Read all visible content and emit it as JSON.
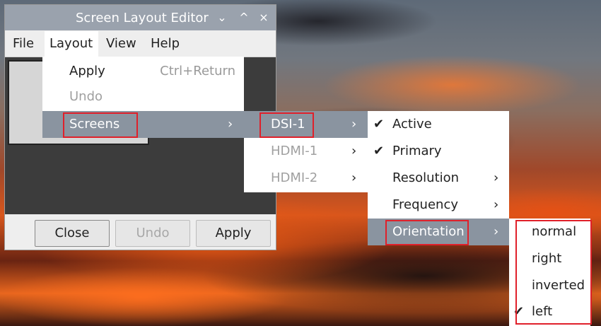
{
  "window": {
    "title": "Screen Layout Editor",
    "controls": {
      "minimize": "⌄",
      "maximize": "^",
      "close": "×"
    }
  },
  "menubar": {
    "items": [
      "File",
      "Layout",
      "View",
      "Help"
    ]
  },
  "layout_menu": {
    "apply": "Apply",
    "apply_shortcut": "Ctrl+Return",
    "undo": "Undo",
    "screens": "Screens"
  },
  "screens_menu": {
    "items": [
      "DSI-1",
      "HDMI-1",
      "HDMI-2"
    ]
  },
  "dsi_menu": {
    "active": "Active",
    "primary": "Primary",
    "resolution": "Resolution",
    "frequency": "Frequency",
    "orientation": "Orientation"
  },
  "orientation_menu": {
    "items": [
      "normal",
      "right",
      "inverted",
      "left"
    ],
    "checked": "left"
  },
  "buttons": {
    "close": "Close",
    "undo": "Undo",
    "apply": "Apply"
  },
  "glyphs": {
    "check": "✔",
    "submenu_arrow": "›"
  },
  "colors": {
    "highlight": "#8a94a0",
    "annotation": "#e0202a"
  }
}
